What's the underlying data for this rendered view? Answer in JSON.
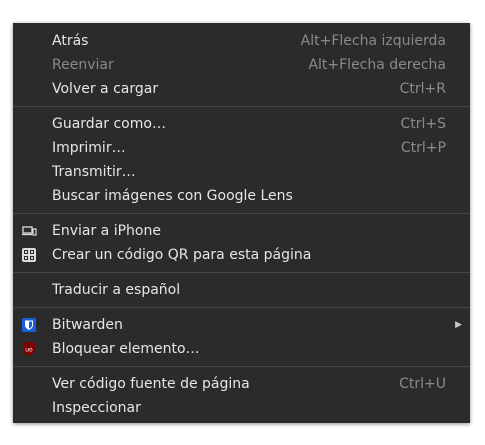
{
  "menu": {
    "back": {
      "label": "Atrás",
      "shortcut": "Alt+Flecha izquierda"
    },
    "forward": {
      "label": "Reenviar",
      "shortcut": "Alt+Flecha derecha"
    },
    "reload": {
      "label": "Volver a cargar",
      "shortcut": "Ctrl+R"
    },
    "save_as": {
      "label": "Guardar como…",
      "shortcut": "Ctrl+S"
    },
    "print": {
      "label": "Imprimir…",
      "shortcut": "Ctrl+P"
    },
    "cast": {
      "label": "Transmitir…"
    },
    "lens": {
      "label": "Buscar imágenes con Google Lens"
    },
    "send_iphone": {
      "label": "Enviar a iPhone",
      "icon": "laptop-phone-icon"
    },
    "qr": {
      "label": "Crear un código QR para esta página",
      "icon": "qr-code-icon"
    },
    "translate": {
      "label": "Traducir a español"
    },
    "bitwarden": {
      "label": "Bitwarden",
      "icon": "bitwarden-shield-icon",
      "icon_color": "#175ddc"
    },
    "block": {
      "label": "Bloquear elemento…",
      "icon": "ublock-origin-icon",
      "icon_color": "#800000"
    },
    "view_source": {
      "label": "Ver código fuente de página",
      "shortcut": "Ctrl+U"
    },
    "inspect": {
      "label": "Inspeccionar"
    }
  },
  "colors": {
    "menu_background": "#2b2b2b",
    "text": "#e6e6e6",
    "disabled_text": "#8a8a8a",
    "separator": "#454545"
  }
}
